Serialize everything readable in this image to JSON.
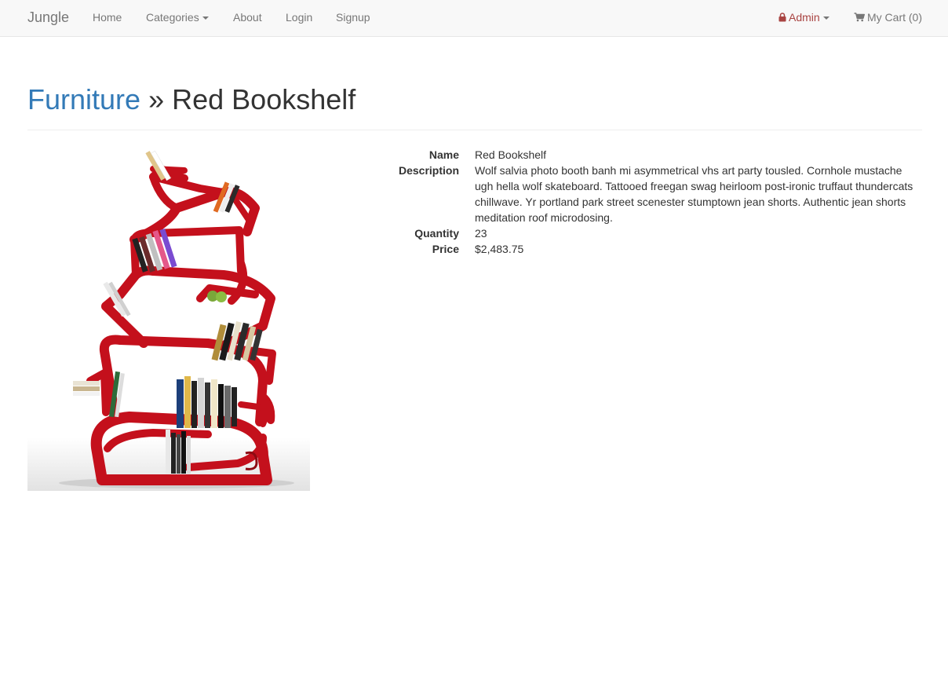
{
  "navbar": {
    "brand": "Jungle",
    "links": [
      "Home",
      "Categories",
      "About",
      "Login",
      "Signup"
    ],
    "admin_label": "Admin",
    "cart_label": "My Cart (0)"
  },
  "header": {
    "category": "Furniture",
    "separator": "»",
    "product_name": "Red Bookshelf"
  },
  "details": {
    "name_label": "Name",
    "name_value": "Red Bookshelf",
    "description_label": "Description",
    "description_value": "Wolf salvia photo booth banh mi asymmetrical vhs art party tousled. Cornhole mustache ugh hella wolf skateboard. Tattooed freegan swag heirloom post-ironic truffaut thundercats chillwave. Yr portland park street scenester stumptown jean shorts. Authentic jean shorts meditation roof microdosing.",
    "quantity_label": "Quantity",
    "quantity_value": "23",
    "price_label": "Price",
    "price_value": "$2,483.75"
  },
  "colors": {
    "brand_link": "#337ab7",
    "admin": "#a94442",
    "shelf_red": "#c4101c"
  }
}
